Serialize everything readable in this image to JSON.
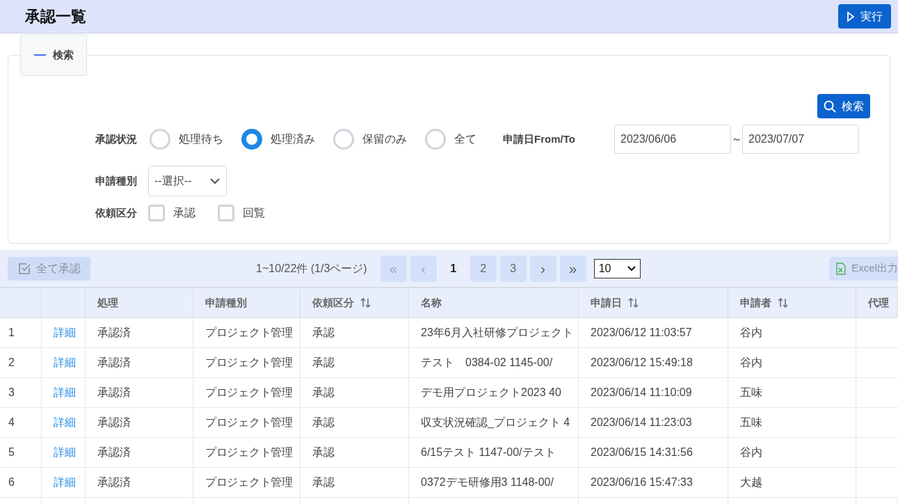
{
  "header": {
    "title": "承認一覧",
    "run_button": "実行"
  },
  "search_panel": {
    "toggle": "検索",
    "search_button": "検索",
    "status": {
      "label": "承認状況",
      "options": [
        {
          "label": "処理待ち",
          "selected": false
        },
        {
          "label": "処理済み",
          "selected": true
        },
        {
          "label": "保留のみ",
          "selected": false
        },
        {
          "label": "全て",
          "selected": false
        }
      ]
    },
    "date_range": {
      "label": "申請日From/To",
      "from": "2023/06/06",
      "separator": "～",
      "to": "2023/07/07"
    },
    "type": {
      "label": "申請種別",
      "value": "--選択--"
    },
    "request_kind": {
      "label": "依頼区分",
      "options": [
        {
          "label": "承認",
          "checked": false
        },
        {
          "label": "回覧",
          "checked": false
        }
      ]
    }
  },
  "toolbar": {
    "approve_all": "全て承認",
    "summary": "1~10/22件 (1/3ページ)",
    "first": "«",
    "prev": "‹",
    "pages": [
      {
        "label": "1",
        "selected": true
      },
      {
        "label": "2",
        "selected": false
      },
      {
        "label": "3",
        "selected": false
      }
    ],
    "next": "›",
    "last": "»",
    "page_size": "10",
    "export": "Excel出力"
  },
  "table": {
    "columns": [
      {
        "sortable": false
      },
      {
        "sortable": false
      },
      {
        "label": "処理",
        "sortable": false
      },
      {
        "label": "申請種別",
        "sortable": false
      },
      {
        "label": "依頼区分",
        "sortable": true
      },
      {
        "label": "名称",
        "sortable": false
      },
      {
        "label": "申請日",
        "sortable": true
      },
      {
        "label": "申請者",
        "sortable": true
      },
      {
        "label": "代理",
        "sortable": false
      }
    ],
    "rows": [
      {
        "no": "1",
        "link": "詳細",
        "status": "承認済",
        "type": "プロジェクト管理",
        "kind": "承認",
        "name": "23年6月入社研修プロジェクト",
        "date": "2023/06/12 11:03:57",
        "applicant": "谷内"
      },
      {
        "no": "2",
        "link": "詳細",
        "status": "承認済",
        "type": "プロジェクト管理",
        "kind": "承認",
        "name": "テスト　0384-02 1145-00/",
        "date": "2023/06/12 15:49:18",
        "applicant": "谷内"
      },
      {
        "no": "3",
        "link": "詳細",
        "status": "承認済",
        "type": "プロジェクト管理",
        "kind": "承認",
        "name": "デモ用プロジェクト2023 40",
        "date": "2023/06/14 11:10:09",
        "applicant": "五味"
      },
      {
        "no": "4",
        "link": "詳細",
        "status": "承認済",
        "type": "プロジェクト管理",
        "kind": "承認",
        "name": "収支状況確認_プロジェクト 4",
        "date": "2023/06/14 11:23:03",
        "applicant": "五味"
      },
      {
        "no": "5",
        "link": "詳細",
        "status": "承認済",
        "type": "プロジェクト管理",
        "kind": "承認",
        "name": "6/15テスト 1147-00/テスト",
        "date": "2023/06/15 14:31:56",
        "applicant": "谷内"
      },
      {
        "no": "6",
        "link": "詳細",
        "status": "承認済",
        "type": "プロジェクト管理",
        "kind": "承認",
        "name": "0372デモ研修用3 1148-00/",
        "date": "2023/06/16 15:47:33",
        "applicant": "大越"
      }
    ]
  }
}
